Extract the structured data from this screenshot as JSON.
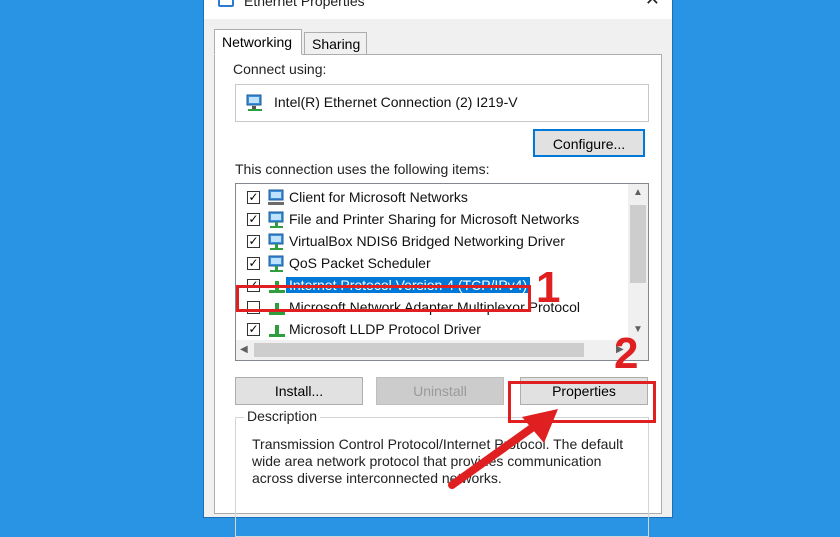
{
  "window": {
    "title": "Ethernet Properties",
    "close_glyph": "✕"
  },
  "tabs": [
    {
      "label": "Networking",
      "active": true
    },
    {
      "label": "Sharing",
      "active": false
    }
  ],
  "connect_using": {
    "label": "Connect using:",
    "adapter": "Intel(R) Ethernet Connection (2) I219-V",
    "icon": "network-adapter-icon"
  },
  "configure_button": "Configure...",
  "items_label": "This connection uses the following items:",
  "items": [
    {
      "label": "Client for Microsoft Networks",
      "checked": true,
      "icon": "network-client-icon"
    },
    {
      "label": "File and Printer Sharing for Microsoft Networks",
      "checked": true,
      "icon": "network-service-icon"
    },
    {
      "label": "VirtualBox NDIS6 Bridged Networking Driver",
      "checked": true,
      "icon": "network-service-icon"
    },
    {
      "label": "QoS Packet Scheduler",
      "checked": true,
      "icon": "network-service-icon"
    },
    {
      "label": "Internet Protocol Version 4 (TCP/IPv4)",
      "checked": true,
      "selected": true,
      "icon": "protocol-icon"
    },
    {
      "label": "Microsoft Network Adapter Multiplexor Protocol",
      "checked": false,
      "icon": "protocol-icon"
    },
    {
      "label": "Microsoft LLDP Protocol Driver",
      "checked": true,
      "icon": "protocol-icon"
    }
  ],
  "buttons": {
    "install": "Install...",
    "uninstall": "Uninstall",
    "properties": "Properties"
  },
  "description": {
    "legend": "Description",
    "text": "Transmission Control Protocol/Internet Protocol. The default wide area network protocol that provides communication across diverse interconnected networks."
  },
  "annotations": {
    "step1": "1",
    "step2": "2",
    "color": "#e02020"
  },
  "colors": {
    "background": "#2a94e4",
    "selection": "#0078d7",
    "accent_border": "#0078d7"
  }
}
